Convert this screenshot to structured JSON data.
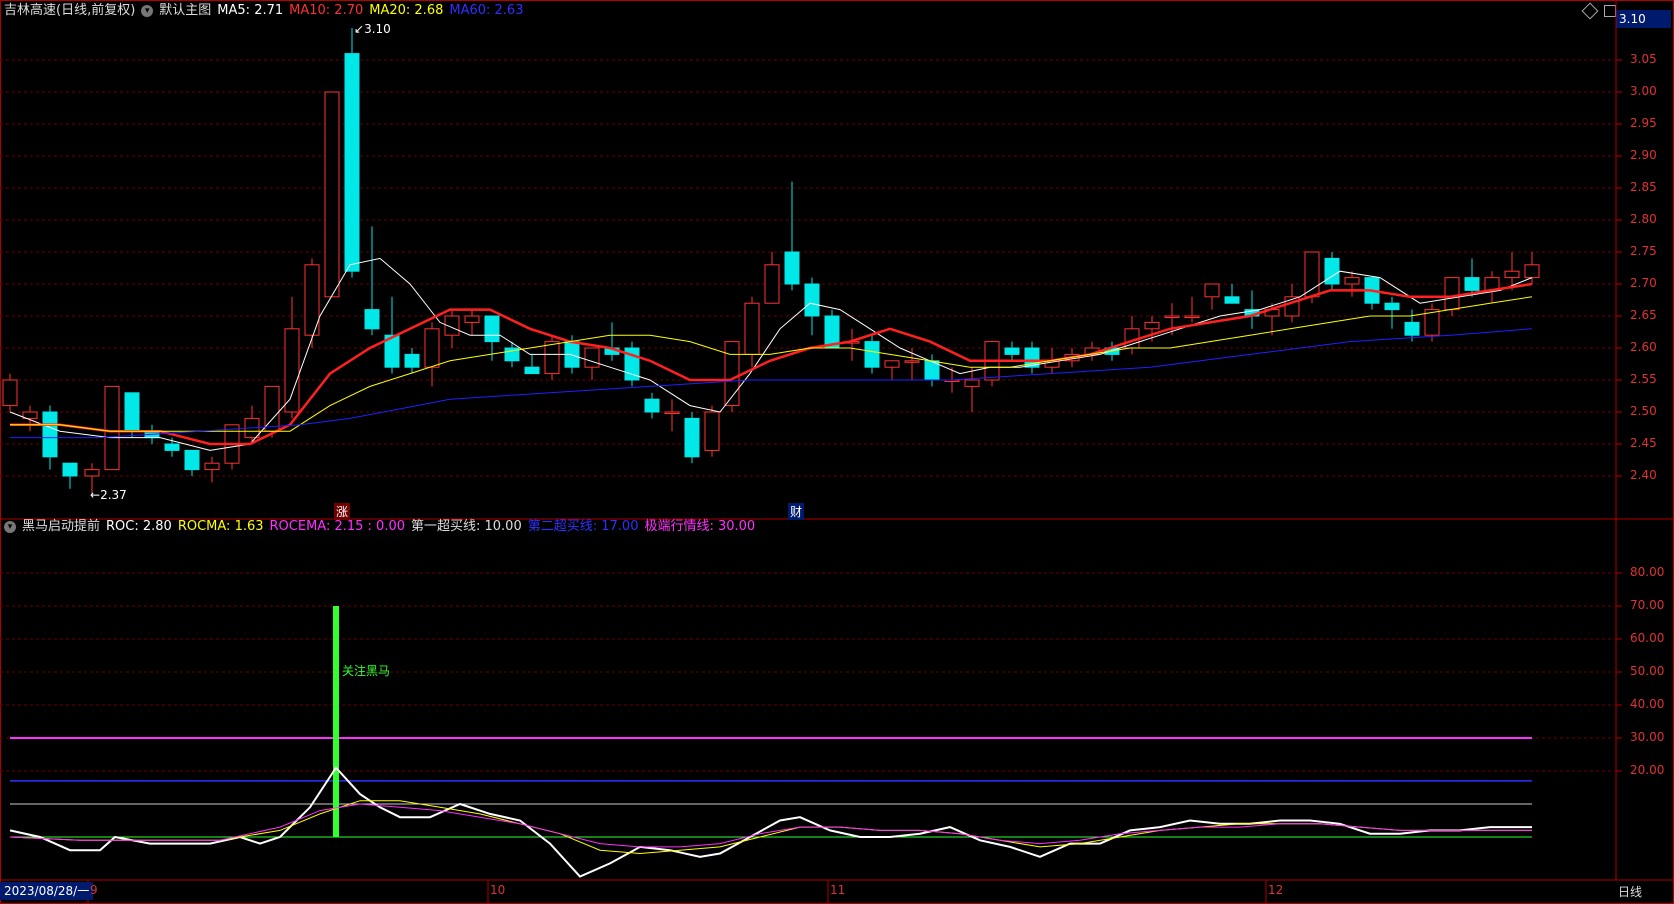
{
  "main": {
    "title": "吉林高速(日线,前复权)",
    "indicator_name": "默认主图",
    "ma5": "MA5: 2.71",
    "ma10": "MA10: 2.70",
    "ma20": "MA20: 2.68",
    "ma60": "MA60: 2.63",
    "last_price": "3.10",
    "y_ticks": [
      "3.05",
      "3.00",
      "2.95",
      "2.90",
      "2.85",
      "2.80",
      "2.75",
      "2.70",
      "2.65",
      "2.60",
      "2.55",
      "2.50",
      "2.45",
      "2.40"
    ],
    "high_label": "3.10",
    "low_label": "2.37",
    "marker_zhang": "涨",
    "marker_cai": "财",
    "icon_diamond": "diamond-icon",
    "icon_square": "square-icon",
    "colors": {
      "up": "#ff3232",
      "down": "#00e8e8",
      "ma5": "#ffffff",
      "ma10": "#ff2020",
      "ma20": "#ffff00",
      "ma60": "#2020ff",
      "grid": "#6b0000",
      "axis": "#b00000"
    }
  },
  "sub": {
    "name": "黑马启动提前",
    "roc": "ROC: 2.80",
    "rocma": "ROCMA: 1.63",
    "rocema": "ROCEMA: 2.15 : 0.00",
    "line1": "第一超买线: 10.00",
    "line2": "第二超买线: 17.00",
    "line3": "极端行情线: 30.00",
    "y_ticks": [
      "80.00",
      "70.00",
      "60.00",
      "50.00",
      "40.00",
      "30.00",
      "20.00"
    ],
    "annotation": "关注黑马"
  },
  "footer": {
    "date": "2023/08/28/一",
    "months": [
      "9",
      "10",
      "11",
      "12"
    ],
    "period": "日线"
  }
}
